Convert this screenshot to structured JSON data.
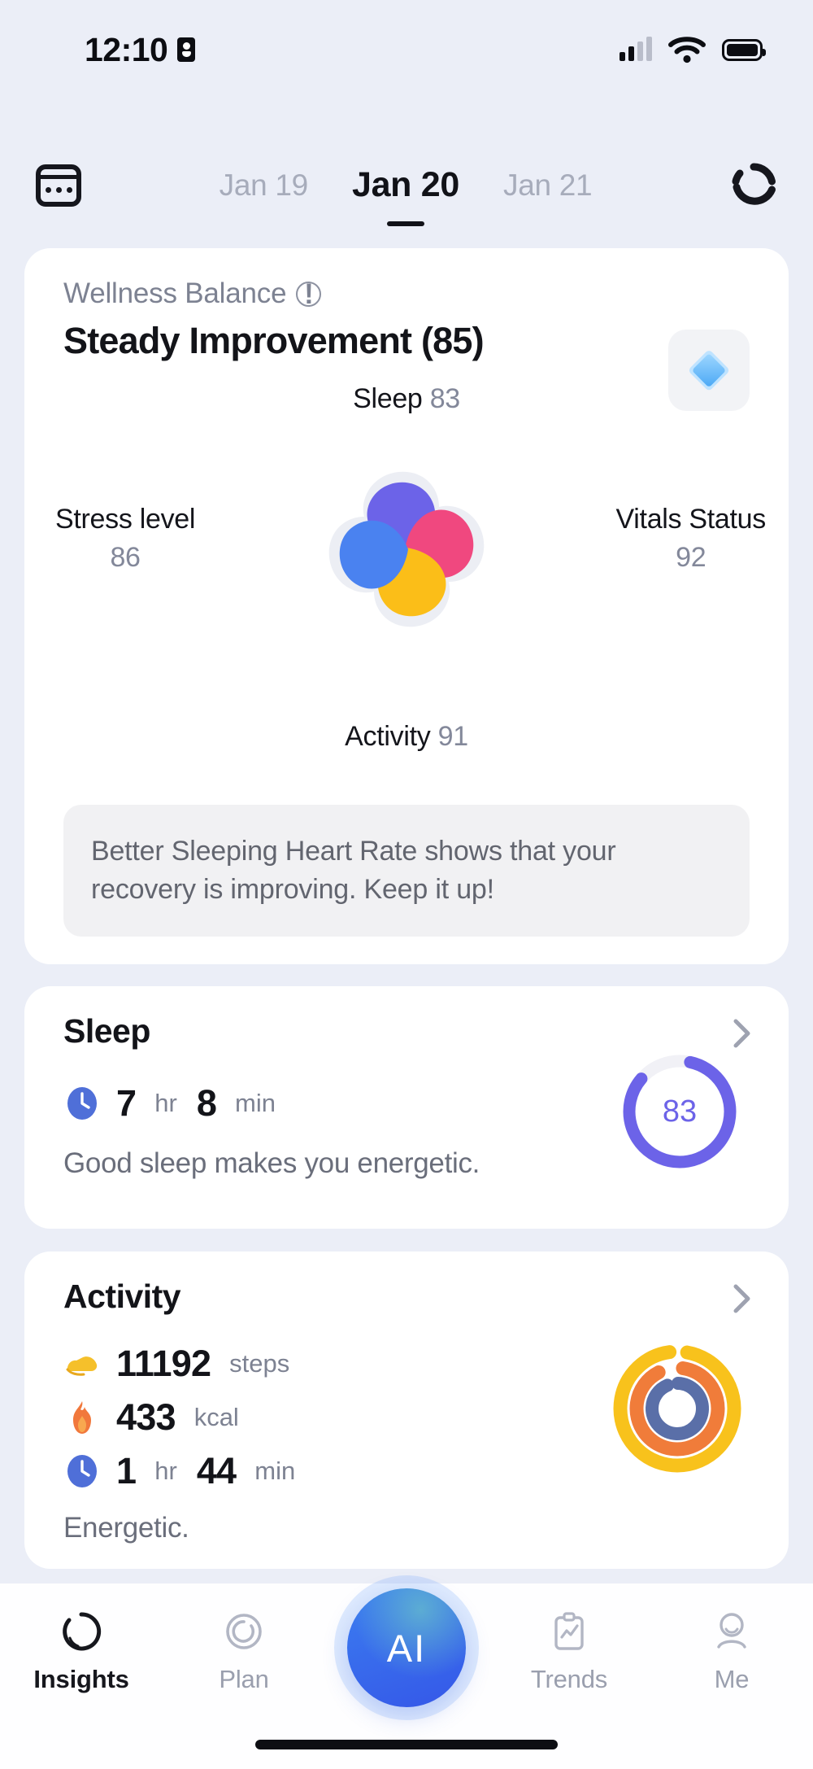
{
  "status_bar": {
    "time": "12:10",
    "badge_icon": "person-badge-icon",
    "signal_icon": "cellular-signal-icon",
    "wifi_icon": "wifi-icon",
    "battery_icon": "battery-icon"
  },
  "date_nav": {
    "calendar_icon": "calendar-icon",
    "sync_icon": "sync-refresh-icon",
    "dates": [
      {
        "label": "Jan 19",
        "active": false
      },
      {
        "label": "Jan 20",
        "active": true
      },
      {
        "label": "Jan 21",
        "active": false
      }
    ]
  },
  "wellness": {
    "label": "Wellness Balance",
    "info_icon": "info-icon",
    "title": "Steady Improvement (85)",
    "score": 85,
    "badge_icon": "diamond-gem-icon",
    "insight": "Better Sleeping Heart Rate shows that your recovery is improving. Keep it up!",
    "petals": {
      "top": {
        "name": "Sleep",
        "value": "83",
        "color": "#6C63E8"
      },
      "right": {
        "name": "Vitals Status",
        "value": "92",
        "color": "#F0487F"
      },
      "bottom": {
        "name": "Activity",
        "value": "91",
        "color": "#FBBE18"
      },
      "left": {
        "name": "Stress level",
        "value": "86",
        "color": "#4A82F0"
      }
    }
  },
  "chart_data": {
    "type": "pie",
    "title": "Wellness Balance",
    "categories": [
      "Sleep",
      "Vitals Status",
      "Activity",
      "Stress level"
    ],
    "values": [
      83,
      92,
      91,
      86
    ],
    "colors": [
      "#6C63E8",
      "#F0487F",
      "#FBBE18",
      "#4A82F0"
    ],
    "overall_score": 85,
    "ylim": [
      0,
      100
    ],
    "legend": "labels around petals",
    "grid": false
  },
  "sleep_card": {
    "title": "Sleep",
    "chevron_icon": "chevron-right-icon",
    "clock_icon": "clock-icon",
    "hours": "7",
    "hours_unit": "hr",
    "minutes": "8",
    "minutes_unit": "min",
    "note": "Good sleep makes you energetic.",
    "ring_value": "83",
    "ring_percent": 83,
    "ring_color": "#6C63E8"
  },
  "activity_card": {
    "title": "Activity",
    "chevron_icon": "chevron-right-icon",
    "note": "Energetic.",
    "metrics": [
      {
        "icon": "shoe-icon",
        "value": "11192",
        "unit": "steps"
      },
      {
        "icon": "flame-icon",
        "value": "433",
        "unit": "kcal"
      },
      {
        "icon": "clock-icon",
        "value": "1",
        "unit": "hr",
        "value2": "44",
        "unit2": "min"
      }
    ],
    "rings": [
      {
        "name": "steps-ring",
        "percent": 95,
        "color": "#F8C21C"
      },
      {
        "name": "calories-ring",
        "percent": 90,
        "color": "#F07C3A"
      },
      {
        "name": "duration-ring",
        "percent": 93,
        "color": "#5A6FA8"
      }
    ]
  },
  "nav": {
    "items": [
      {
        "label": "Insights",
        "icon": "insights-ring-icon",
        "active": true
      },
      {
        "label": "Plan",
        "icon": "plan-circle-icon",
        "active": false
      },
      {
        "label": "Trends",
        "icon": "trends-clipboard-icon",
        "active": false
      },
      {
        "label": "Me",
        "icon": "profile-person-icon",
        "active": false
      }
    ],
    "ai_button": {
      "label": "AI",
      "icon": "ai-assistant-icon"
    }
  }
}
